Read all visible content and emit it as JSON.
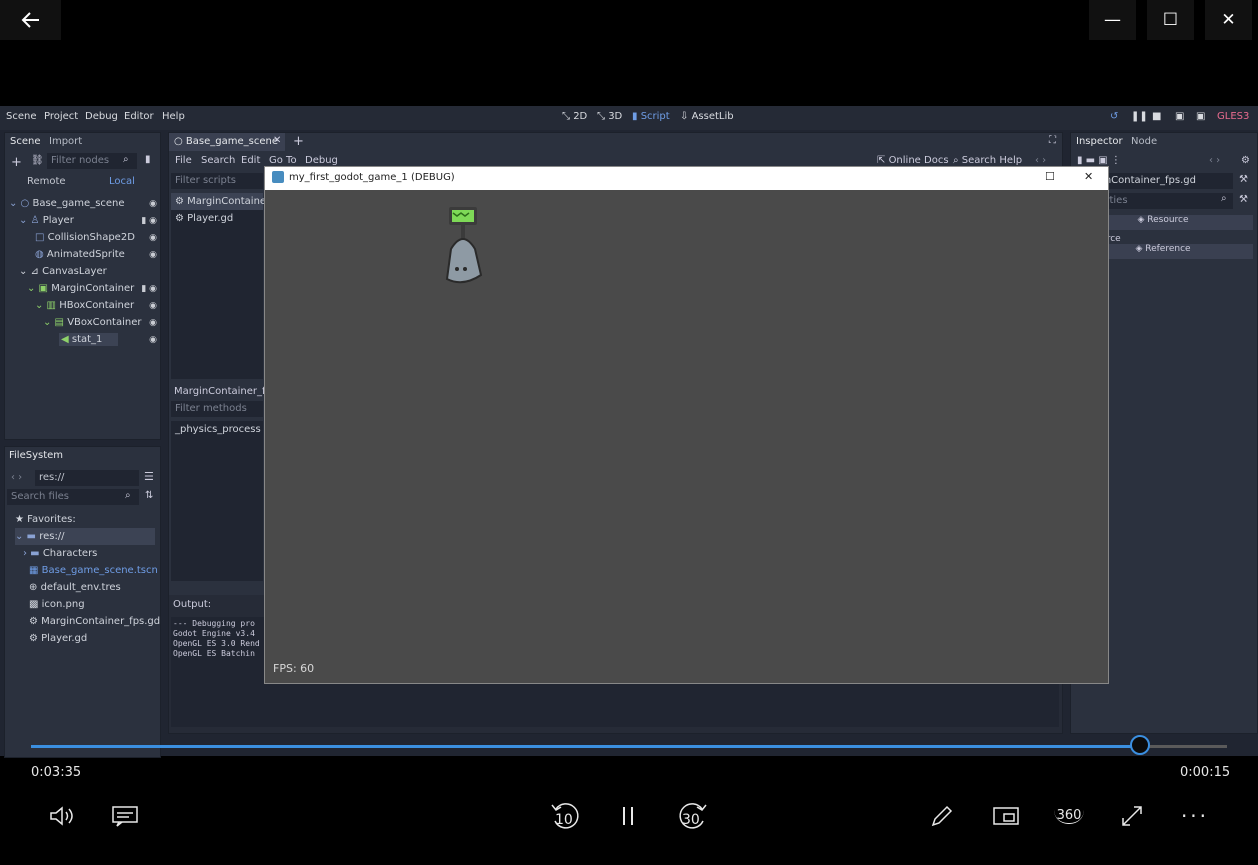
{
  "window": {
    "back_icon": "back-arrow-icon",
    "minimize": "—",
    "maximize": "☐",
    "close": "✕"
  },
  "editor": {
    "menus": [
      "Scene",
      "Project",
      "Debug",
      "Editor",
      "Help"
    ],
    "modes": [
      "2D",
      "3D",
      "Script",
      "AssetLib"
    ],
    "renderer": "GLES3",
    "scene_panel": {
      "tabs": [
        "Scene",
        "Import"
      ],
      "filter_placeholder": "Filter nodes",
      "remote": "Remote",
      "local": "Local",
      "tree": [
        {
          "label": "Base_game_scene"
        },
        {
          "label": "Player"
        },
        {
          "label": "CollisionShape2D"
        },
        {
          "label": "AnimatedSprite"
        },
        {
          "label": "CanvasLayer"
        },
        {
          "label": "MarginContainer"
        },
        {
          "label": "HBoxContainer"
        },
        {
          "label": "VBoxContainer"
        },
        {
          "label": "stat_1"
        }
      ]
    },
    "filesystem": {
      "tab": "FileSystem",
      "path": "res://",
      "search_placeholder": "Search files",
      "items": [
        {
          "label": "Favorites:"
        },
        {
          "label": "res://"
        },
        {
          "label": "Characters"
        },
        {
          "label": "Base_game_scene.tscn"
        },
        {
          "label": "default_env.tres"
        },
        {
          "label": "icon.png"
        },
        {
          "label": "MarginContainer_fps.gd"
        },
        {
          "label": "Player.gd"
        }
      ]
    },
    "script_panel": {
      "tab": "Base_game_scene",
      "menus": [
        "File",
        "Search",
        "Edit",
        "Go To",
        "Debug"
      ],
      "online_docs": "Online Docs",
      "search_help": "Search Help",
      "filter_scripts": "Filter scripts",
      "scripts": [
        "MarginContainer_",
        "Player.gd"
      ],
      "method_header": "MarginContainer_fp",
      "filter_methods": "Filter methods",
      "methods": [
        "_physics_process"
      ]
    },
    "output": {
      "title": "Output:",
      "lines": [
        "--- Debugging pro",
        "Godot Engine v3.4",
        "OpenGL ES 3.0 Rend",
        "OpenGL ES Batchin"
      ]
    },
    "inspector": {
      "tabs": [
        "Inspector",
        "Node"
      ],
      "file": "MarginContainer_fps.gd",
      "filter": "Properties",
      "resource_label": "Resource",
      "source": "urce",
      "reference_label": "Reference"
    }
  },
  "game_window": {
    "title": "my_first_godot_game_1 (DEBUG)",
    "fps_text": "FPS: 60"
  },
  "player": {
    "elapsed": "0:03:35",
    "remaining": "0:00:15",
    "progress": 0.927,
    "controls": [
      "volume-icon",
      "subtitles-icon",
      "rewind-10-icon",
      "pause-icon",
      "forward-30-icon",
      "edit-icon",
      "mini-view-icon",
      "360-icon",
      "fullscreen-icon",
      "more-icon"
    ],
    "rewind_label": "10",
    "forward_label": "30",
    "vr_label": "360"
  },
  "colors": {
    "accent": "#3b8fe0",
    "godot_bg": "#202531",
    "game_bg": "#4a4a4a"
  }
}
